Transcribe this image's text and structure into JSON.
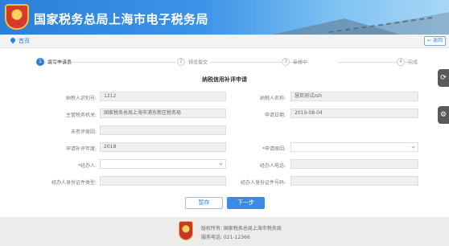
{
  "header": {
    "title": "国家税务总局上海市电子税务局"
  },
  "nav": {
    "home": "首页",
    "back": "返回"
  },
  "steps": [
    {
      "num": "1",
      "label": "填写申请表"
    },
    {
      "num": "2",
      "label": "预览提交"
    },
    {
      "num": "3",
      "label": "审核中"
    },
    {
      "num": "4",
      "label": "完成"
    }
  ],
  "form": {
    "title": "纳税信用补评申请",
    "fields": {
      "taxpayer_id": {
        "label": "纳税人识别号:",
        "value": "1212"
      },
      "taxpayer_name": {
        "label": "纳税人名称:",
        "value": "慧邦测试zsh"
      },
      "tax_office": {
        "label": "主管税务机关:",
        "value": "国家税务总局上海市浦东新区税务局"
      },
      "apply_date": {
        "label": "申请日期:",
        "value": "2019-08-04"
      },
      "unrated_reason": {
        "label": "未参评原因:",
        "value": ""
      },
      "apply_year": {
        "label": "申请补评年度:",
        "value": "2018"
      },
      "apply_reason": {
        "label": "*申请原因:",
        "value": ""
      },
      "handler": {
        "label": "*经办人:",
        "value": ""
      },
      "handler_phone": {
        "label": "经办人电话:",
        "value": ""
      },
      "handler_id_type": {
        "label": "经办人身份证件类型:",
        "value": ""
      },
      "handler_id_no": {
        "label": "经办人身份证件号码:",
        "value": ""
      }
    },
    "buttons": {
      "save": "暂存",
      "next": "下一步"
    }
  },
  "side_tools": {
    "tool1": "⟳",
    "tool2": "⚙"
  },
  "footer": {
    "copyright": "版权所有:  国家税务总局上海市税务局",
    "phone": "服务电话:  021-12366"
  }
}
